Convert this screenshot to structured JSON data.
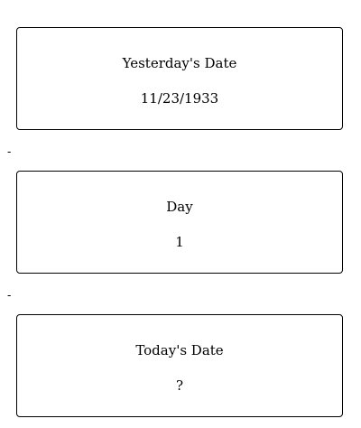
{
  "cards": [
    {
      "label": "Yesterday's Date",
      "value": "11/23/1933"
    },
    {
      "label": "Day",
      "value": "1"
    },
    {
      "label": "Today's Date",
      "value": "?"
    }
  ],
  "separators": [
    "-",
    "-"
  ]
}
